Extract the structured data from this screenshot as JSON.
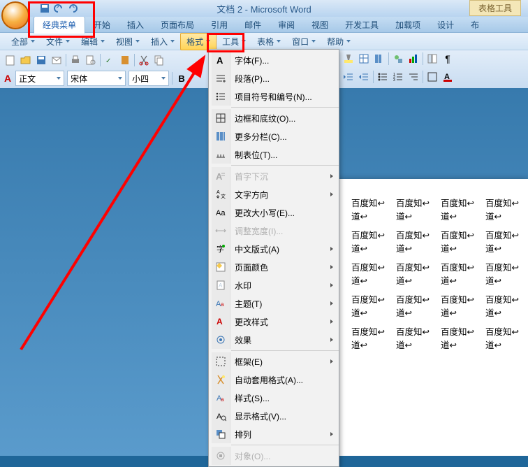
{
  "title": "文档 2 - Microsoft Word",
  "context_tab": "表格工具",
  "ribbon_tabs": [
    "经典菜单",
    "开始",
    "插入",
    "页面布局",
    "引用",
    "邮件",
    "审阅",
    "视图",
    "开发工具",
    "加载项",
    "设计",
    "布"
  ],
  "menus": [
    "全部",
    "文件",
    "编辑",
    "视图",
    "插入",
    "格式",
    "工具",
    "表格",
    "窗口",
    "帮助"
  ],
  "style_value": "正文",
  "font_value": "宋体",
  "size_value": "小四",
  "style_A_label": "A",
  "format_label": "格式",
  "dropdown": [
    {
      "icon": "font-icon",
      "label": "字体(F)...",
      "sub": false,
      "disabled": false
    },
    {
      "icon": "para-icon",
      "label": "段落(P)...",
      "sub": false,
      "disabled": false
    },
    {
      "icon": "bullets-icon",
      "label": "项目符号和编号(N)...",
      "sub": false,
      "disabled": false
    },
    {
      "sep": true
    },
    {
      "icon": "border-icon",
      "label": "边框和底纹(O)...",
      "sub": false,
      "disabled": false
    },
    {
      "icon": "columns-icon",
      "label": "更多分栏(C)...",
      "sub": false,
      "disabled": false
    },
    {
      "icon": "tabs-icon",
      "label": "制表位(T)...",
      "sub": false,
      "disabled": false
    },
    {
      "sep": true
    },
    {
      "icon": "dropcap-icon",
      "label": "首字下沉",
      "sub": true,
      "disabled": true
    },
    {
      "icon": "textdir-icon",
      "label": "文字方向",
      "sub": true,
      "disabled": false
    },
    {
      "icon": "case-icon",
      "label": "更改大小写(E)...",
      "sub": false,
      "disabled": false
    },
    {
      "icon": "width-icon",
      "label": "调整宽度(I)...",
      "sub": false,
      "disabled": true
    },
    {
      "icon": "cjk-icon",
      "label": "中文版式(A)",
      "sub": true,
      "disabled": false
    },
    {
      "icon": "bgcolor-icon",
      "label": "页面颜色",
      "sub": true,
      "disabled": false
    },
    {
      "icon": "watermark-icon",
      "label": "水印",
      "sub": true,
      "disabled": false
    },
    {
      "icon": "theme-icon",
      "label": "主题(T)",
      "sub": true,
      "disabled": false
    },
    {
      "icon": "chstyle-icon",
      "label": "更改样式",
      "sub": true,
      "disabled": false
    },
    {
      "icon": "effects-icon",
      "label": "效果",
      "sub": true,
      "disabled": false
    },
    {
      "sep": true
    },
    {
      "icon": "frame-icon",
      "label": "框架(E)",
      "sub": true,
      "disabled": false
    },
    {
      "icon": "autofmt-icon",
      "label": "自动套用格式(A)...",
      "sub": false,
      "disabled": false
    },
    {
      "icon": "styles-icon",
      "label": "样式(S)...",
      "sub": false,
      "disabled": false
    },
    {
      "icon": "reveal-icon",
      "label": "显示格式(V)...",
      "sub": false,
      "disabled": false
    },
    {
      "icon": "arrange-icon",
      "label": "排列",
      "sub": true,
      "disabled": false
    },
    {
      "sep": true
    },
    {
      "icon": "object-icon",
      "label": "对象(O)...",
      "sub": false,
      "disabled": true
    }
  ],
  "cell_text": "百度知道",
  "cell_line1": "百度知",
  "cell_line2": "道"
}
